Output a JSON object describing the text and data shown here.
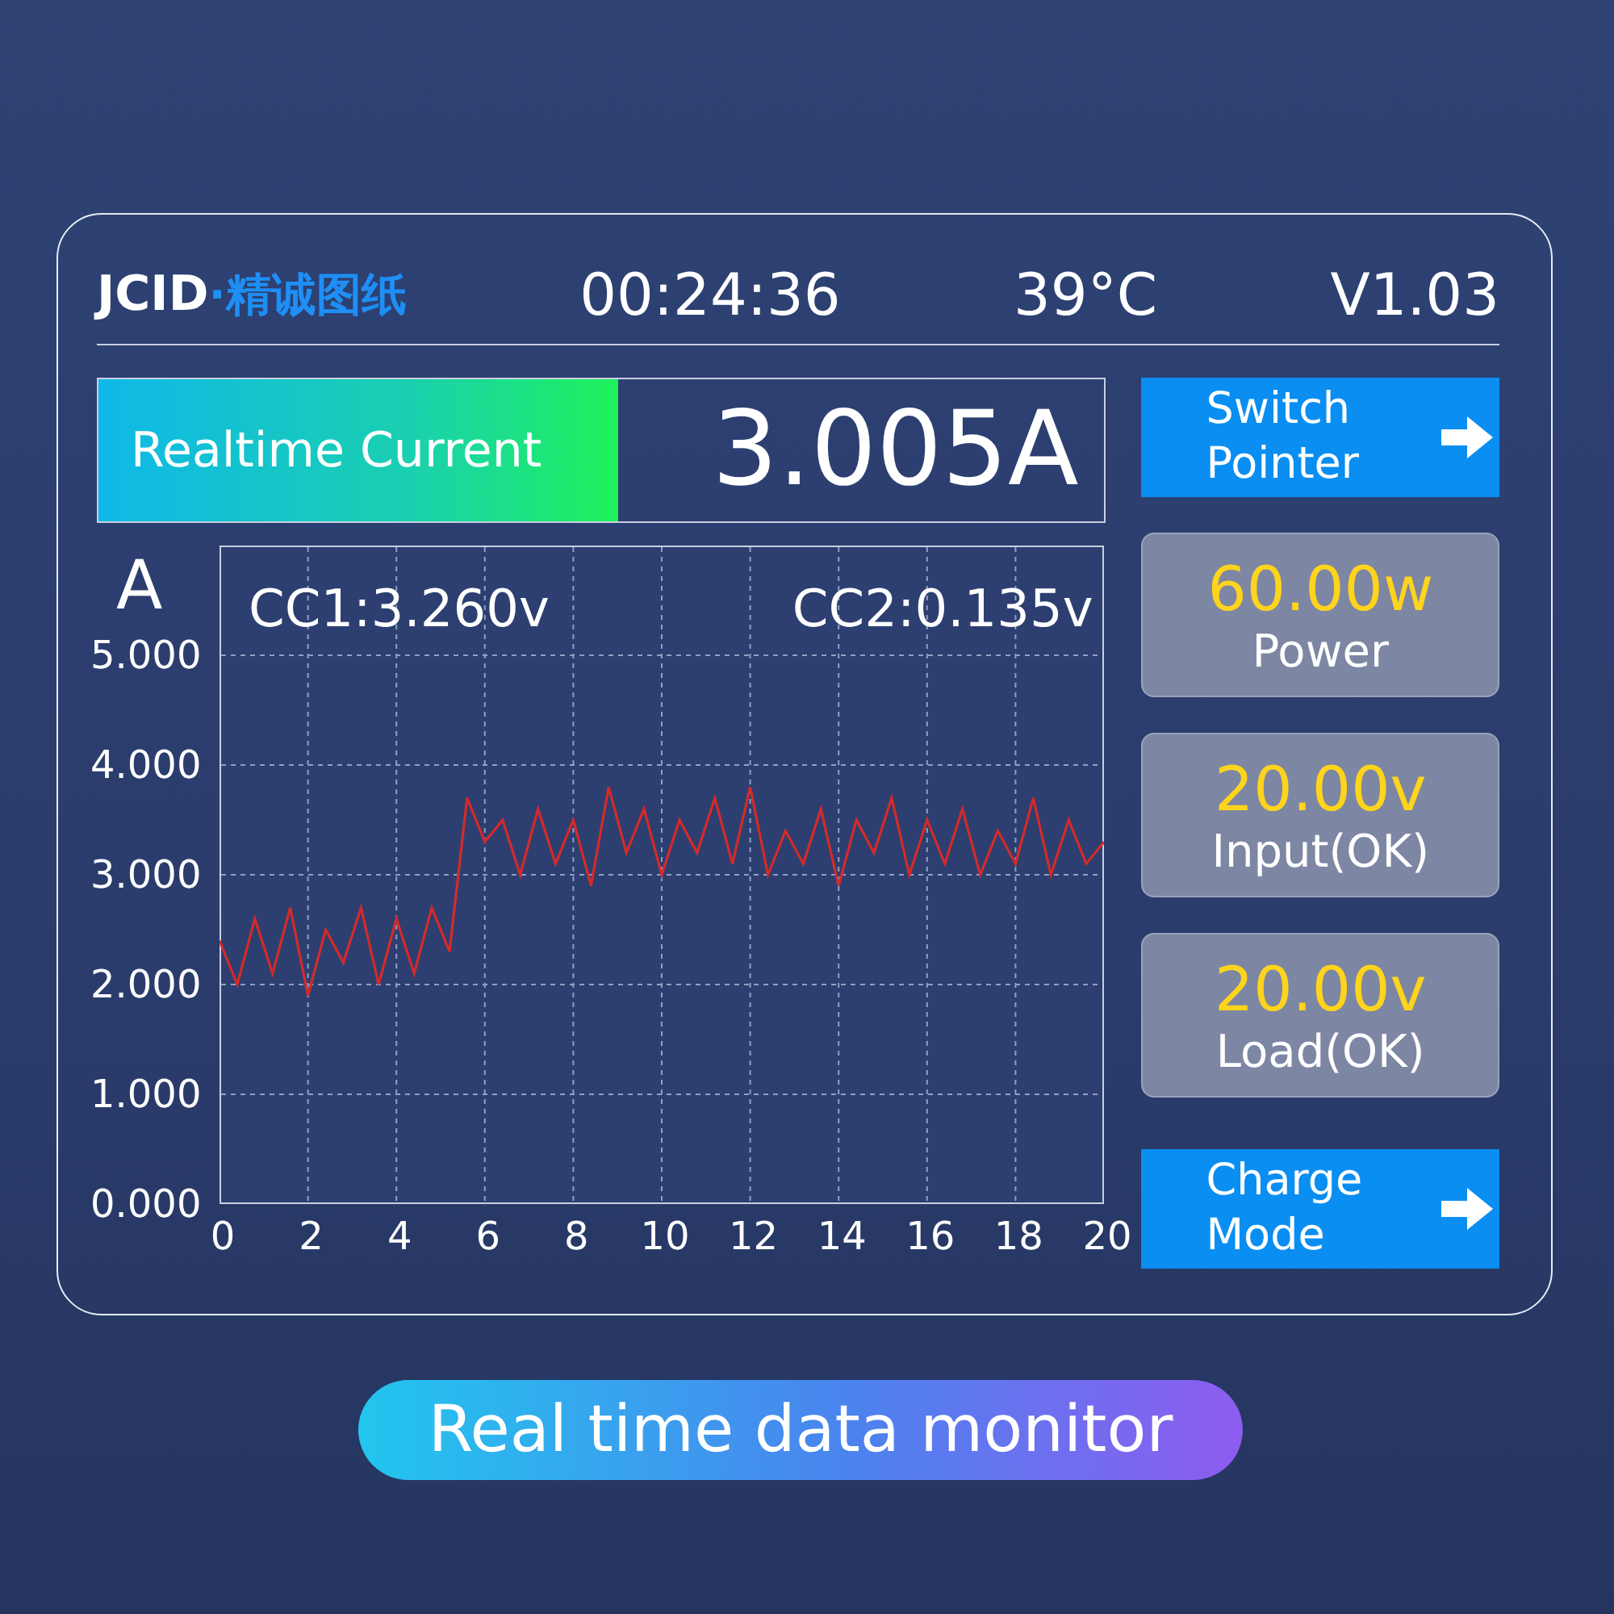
{
  "header": {
    "brand": "JCID",
    "brand_sub": "·精诚图纸",
    "time": "00:24:36",
    "temperature": "39°C",
    "version": "V1.03"
  },
  "current": {
    "label": "Realtime Current",
    "value": "3.005A"
  },
  "chart": {
    "cc1": "CC1:3.260v",
    "cc2": "CC2:0.135v",
    "chart_data": {
      "type": "line",
      "grid": true,
      "ylabel": "A",
      "xlim": [
        0,
        20
      ],
      "ylim": [
        0,
        6
      ],
      "x": [
        0,
        0.4,
        0.8,
        1.2,
        1.6,
        2,
        2.4,
        2.8,
        3.2,
        3.6,
        4,
        4.4,
        4.8,
        5.2,
        5.6,
        6,
        6.4,
        6.8,
        7.2,
        7.6,
        8,
        8.4,
        8.8,
        9.2,
        9.6,
        10,
        10.4,
        10.8,
        11.2,
        11.6,
        12,
        12.4,
        12.8,
        13.2,
        13.6,
        14,
        14.4,
        14.8,
        15.2,
        15.6,
        16,
        16.4,
        16.8,
        17.2,
        17.6,
        18,
        18.4,
        18.8,
        19.2,
        19.6,
        20
      ],
      "series": [
        {
          "color": "#d42a2a",
          "values": [
            2.4,
            2.0,
            2.6,
            2.1,
            2.7,
            1.9,
            2.5,
            2.2,
            2.7,
            2.0,
            2.6,
            2.1,
            2.7,
            2.3,
            3.7,
            3.3,
            3.5,
            3.0,
            3.6,
            3.1,
            3.5,
            2.9,
            3.8,
            3.2,
            3.6,
            3.0,
            3.5,
            3.2,
            3.7,
            3.1,
            3.8,
            3.0,
            3.4,
            3.1,
            3.6,
            2.9,
            3.5,
            3.2,
            3.7,
            3.0,
            3.5,
            3.1,
            3.6,
            3.0,
            3.4,
            3.1,
            3.7,
            3.0,
            3.5,
            3.1,
            3.3
          ]
        }
      ],
      "xticks": [
        0,
        2,
        4,
        6,
        8,
        10,
        12,
        14,
        16,
        18,
        20
      ],
      "yticks": [
        {
          "value": 5,
          "label": "5.000"
        },
        {
          "value": 4,
          "label": "4.000"
        },
        {
          "value": 3,
          "label": "3.000"
        },
        {
          "value": 2,
          "label": "2.000"
        },
        {
          "value": 1,
          "label": "1.000"
        },
        {
          "value": 0,
          "label": "0.000"
        }
      ]
    }
  },
  "side": [
    {
      "kind": "button",
      "label": "Switch Pointer"
    },
    {
      "kind": "reading",
      "value": "60.00w",
      "label": "Power"
    },
    {
      "kind": "reading",
      "value": "20.00v",
      "label": "Input(OK)"
    },
    {
      "kind": "reading",
      "value": "20.00v",
      "label": "Load(OK)"
    },
    {
      "kind": "button",
      "label": "Charge Mode"
    }
  ],
  "banner": "Real time data monitor"
}
